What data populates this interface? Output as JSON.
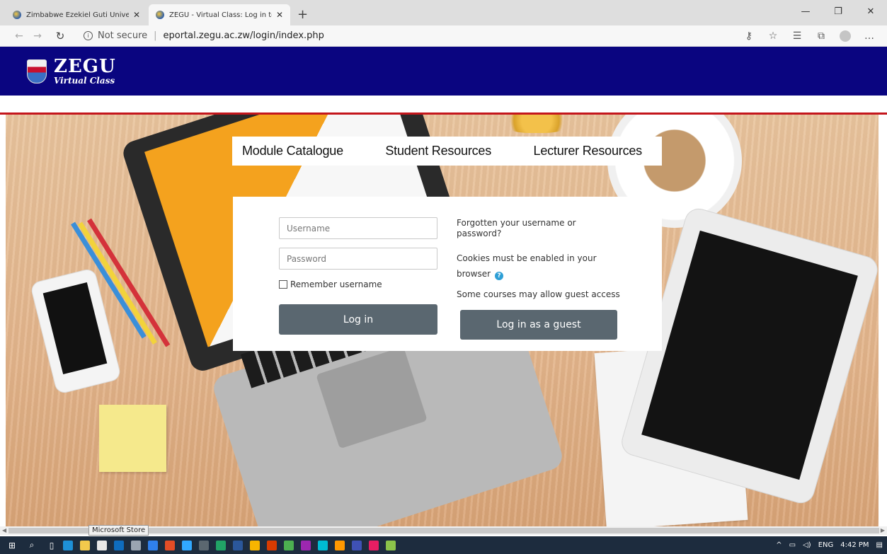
{
  "browser": {
    "tabs": [
      {
        "title": "Zimbabwe Ezekiel Guti Universit",
        "active": false
      },
      {
        "title": "ZEGU - Virtual Class: Log in to th",
        "active": true
      }
    ],
    "new_tab": "+",
    "window_controls": {
      "minimize": "—",
      "maximize": "❐",
      "close": "✕"
    },
    "nav": {
      "back": "←",
      "forward": "→",
      "refresh": "↻"
    },
    "address": {
      "security": "Not secure",
      "separator": "|",
      "url": "eportal.zegu.ac.zw/login/index.php"
    },
    "toolbar_icons": [
      "key-icon",
      "favorite-star-icon",
      "favorites-icon",
      "collections-icon",
      "profile-icon",
      "more-icon"
    ]
  },
  "site": {
    "brand_title": "ZEGU",
    "brand_subtitle": "Virtual Class",
    "colors": {
      "header": "#0a0580",
      "accent_line": "#c4161c",
      "button": "#5a6770",
      "help": "#2e9fd6"
    }
  },
  "menu": {
    "items": [
      "Module Catalogue",
      "Student Resources",
      "Lecturer Resources"
    ]
  },
  "login": {
    "username_placeholder": "Username",
    "password_placeholder": "Password",
    "remember_label": "Remember username",
    "login_button": "Log in",
    "forgot_line1": "Forgotten your username or",
    "forgot_line2": "password?",
    "cookies_line1": "Cookies must be enabled in your",
    "cookies_line2": "browser",
    "guest_note": "Some courses may allow guest access",
    "guest_button": "Log in as a guest"
  },
  "tooltip": "Microsoft Store",
  "taskbar": {
    "language": "ENG",
    "time": "4:42 PM"
  }
}
